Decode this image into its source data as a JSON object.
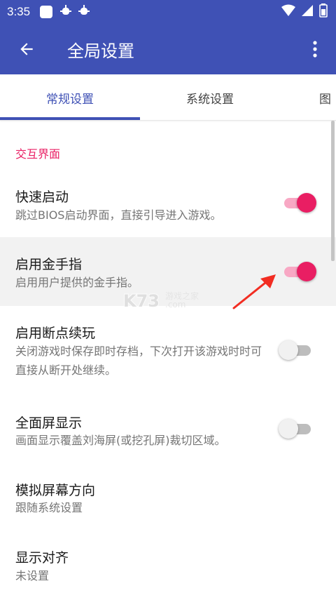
{
  "status_bar": {
    "time": "3:35"
  },
  "toolbar": {
    "title": "全局设置"
  },
  "tabs": [
    {
      "label": "常规设置"
    },
    {
      "label": "系统设置"
    },
    {
      "label": "图"
    }
  ],
  "section": {
    "title": "交互界面"
  },
  "prefs": [
    {
      "title": "快速启动",
      "summary": "跳过BIOS启动界面，直接引导进入游戏。",
      "enabled": true
    },
    {
      "title": "启用金手指",
      "summary": "启用用户提供的金手指。",
      "enabled": true
    },
    {
      "title": "启用断点续玩",
      "summary": "关闭游戏时保存即时存档，下次打开该游戏时时可直接从断开处继续。",
      "enabled": false
    },
    {
      "title": "全面屏显示",
      "summary": "画面显示覆盖刘海屏(或挖孔屏)裁切区域。",
      "enabled": false
    },
    {
      "title": "模拟屏幕方向",
      "summary": "跟随系统设置"
    },
    {
      "title": "显示对齐",
      "summary": "未设置"
    }
  ],
  "watermark": {
    "text": "游戏之家",
    "domain": ".com"
  },
  "colors": {
    "primary": "#3f51b5",
    "accent": "#e91e63"
  }
}
